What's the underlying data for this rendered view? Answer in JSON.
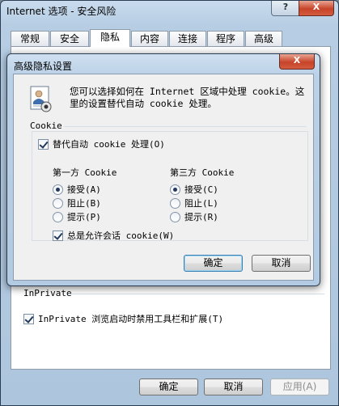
{
  "outer_window": {
    "title": "Internet 选项 - 安全风险",
    "help_button": "?",
    "close_button": "X",
    "tabs": [
      {
        "label": "常规",
        "active": false
      },
      {
        "label": "安全",
        "active": false
      },
      {
        "label": "隐私",
        "active": true
      },
      {
        "label": "内容",
        "active": false
      },
      {
        "label": "连接",
        "active": false
      },
      {
        "label": "程序",
        "active": false
      },
      {
        "label": "高级",
        "active": false
      }
    ],
    "inprivate": {
      "group_label": "InPrivate",
      "checkbox_label": "InPrivate 浏览启动时禁用工具栏和扩展(T)",
      "checked": true
    },
    "buttons": {
      "ok": "确定",
      "cancel": "取消",
      "apply": "应用(A)"
    }
  },
  "dialog": {
    "title": "高级隐私设置",
    "close_button": "X",
    "intro_text": "您可以选择如何在 Internet 区域中处理 cookie。这里的设置替代自动 cookie 处理。",
    "section_label": "Cookie",
    "override_checkbox": {
      "label": "替代自动 cookie 处理(O)",
      "checked": true
    },
    "first_party": {
      "header": "第一方 Cookie",
      "options": [
        {
          "label": "接受(A)",
          "selected": true
        },
        {
          "label": "阻止(B)",
          "selected": false
        },
        {
          "label": "提示(P)",
          "selected": false
        }
      ]
    },
    "third_party": {
      "header": "第三方 Cookie",
      "options": [
        {
          "label": "接受(C)",
          "selected": true
        },
        {
          "label": "阻止(L)",
          "selected": false
        },
        {
          "label": "提示(R)",
          "selected": false
        }
      ]
    },
    "session_checkbox": {
      "label": "总是允许会话 cookie(W)",
      "checked": true
    },
    "buttons": {
      "ok": "确定",
      "cancel": "取消"
    }
  },
  "icons": {
    "privacy": "privacy-certificate-icon",
    "check": "check-icon",
    "radio": "radio-dot-icon"
  }
}
